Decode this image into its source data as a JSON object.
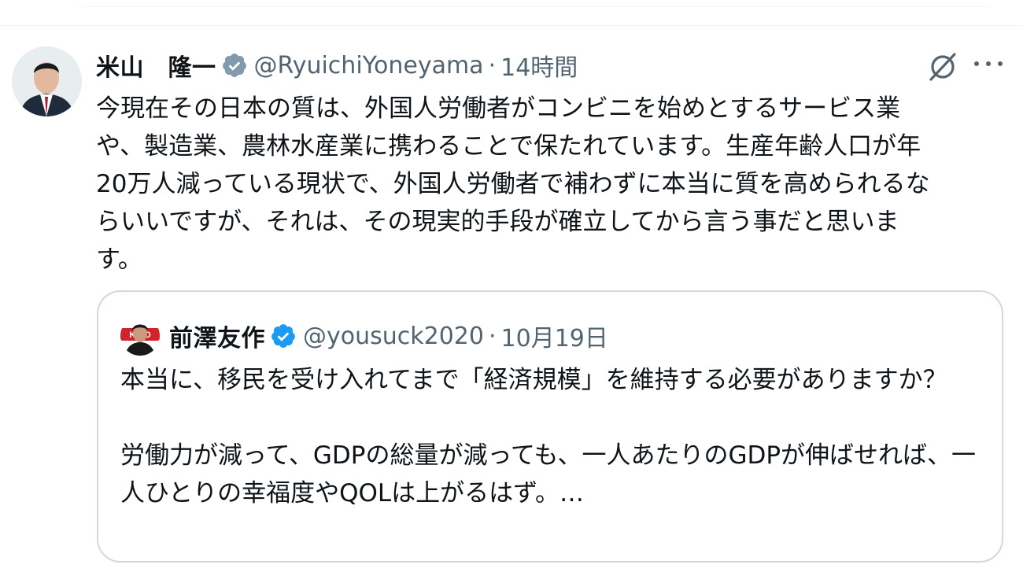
{
  "tweet": {
    "author_name": "米山　隆一",
    "author_handle": "@RyuichiYoneyama",
    "separator": "·",
    "time": "14時間",
    "text": "今現在その日本の質は、外国人労働者がコンビニを始めとするサービス業\nや、製造業、農林水産業に携わることで保たれています。生産年齢人口が年\n20万人減っている現状で、外国人労働者で補わずに本当に質を高められるな\nらいいですが、それは、その現実的手段が確立してから言う事だと思いま\nす。"
  },
  "quoted": {
    "author_name": "前澤友作",
    "author_handle": "@yousuck2020",
    "separator": "·",
    "date": "10月19日",
    "text": "本当に、移民を受け入れてまで「経済規模」を維持する必要がありますか？\n\n労働力が減って、GDPの総量が減っても、一人あたりのGDPが伸ばせれば、一人ひとりの幸福度やQOLは上がるはず。…",
    "avatar_badge": "KIBO"
  },
  "icons": {
    "verified": "verified-badge-icon",
    "grok": "grok-icon",
    "more": "more-options-icon"
  },
  "colors": {
    "verified": "#829aab",
    "verified_blue": "#1d9bf0",
    "secondary_text": "#536471",
    "border": "#cfd9de"
  }
}
